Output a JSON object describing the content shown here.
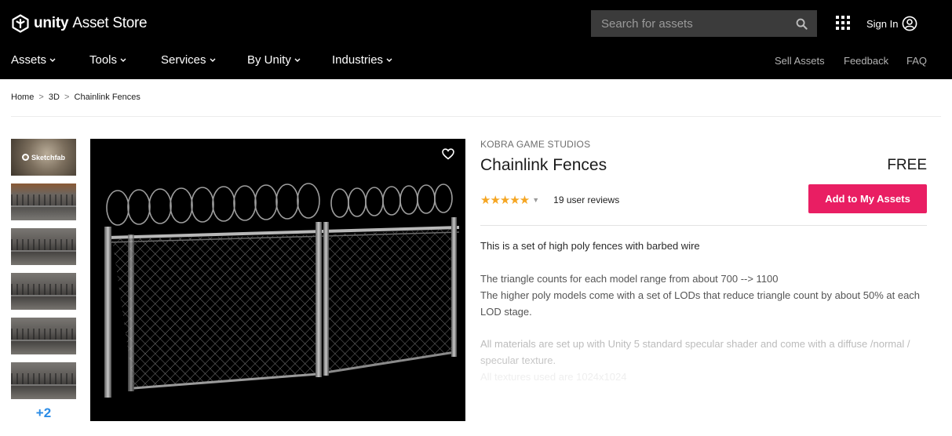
{
  "header": {
    "logo_unity": "unity",
    "logo_store": "Asset Store",
    "search_placeholder": "Search for assets",
    "sign_in": "Sign In"
  },
  "nav": {
    "items": [
      "Assets",
      "Tools",
      "Services",
      "By Unity",
      "Industries"
    ],
    "right": [
      "Sell Assets",
      "Feedback",
      "FAQ"
    ]
  },
  "breadcrumb": [
    "Home",
    "3D",
    "Chainlink Fences"
  ],
  "breadcrumb_separator": ">",
  "gallery": {
    "thumbnails": [
      {
        "label": "Sketchfab",
        "icon": "sketchfab-icon"
      },
      {
        "label": ""
      },
      {
        "label": ""
      },
      {
        "label": ""
      },
      {
        "label": ""
      },
      {
        "label": ""
      }
    ],
    "more_count": "+2"
  },
  "product": {
    "publisher": "KOBRA GAME STUDIOS",
    "title": "Chainlink Fences",
    "price": "FREE",
    "rating": 5,
    "stars": "★★★★★",
    "reviews": "19 user reviews",
    "add_button": "Add to My Assets"
  },
  "description": {
    "line1": "This is a set of high poly fences with barbed wire",
    "line2": "The triangle counts for each model range from about 700 --> 1100",
    "line3": "The higher poly models come with a set of LODs that reduce triangle count by about 50% at each LOD stage.",
    "line4": "All materials are set up with Unity 5 standard specular shader and come with a diffuse /normal / specular texture.",
    "line5": "All textures used are 1024x1024"
  },
  "colors": {
    "header_bg": "#000000",
    "accent_pink": "#e91e63",
    "star_color": "#f5a623",
    "link_blue": "#2b8ce6"
  }
}
